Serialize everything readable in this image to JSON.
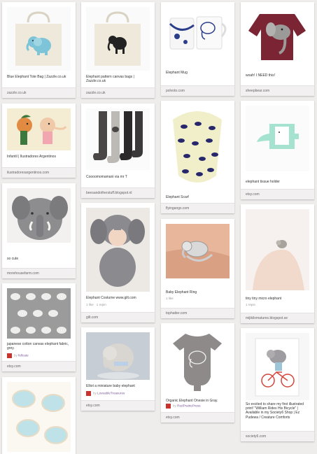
{
  "colors": {
    "background": "#efedec",
    "card": "#ffffff",
    "source_bar": "#f2f0f0",
    "avatar": "#c8332e"
  },
  "columns": [
    [
      {
        "description": "Blue Elephant Tote Bag | Zazzle.co.uk",
        "source": "zazzle.co.uk"
      },
      {
        "description": "Infantil | Ilustradores Argentinos",
        "source": "ilustradoresargentinos.com"
      },
      {
        "description": "so cute",
        "source": "morehousefarm.com"
      },
      {
        "description": "japanese cotton canvas elephant fabric, grey.",
        "via_by": "by",
        "via_user": "fellcate",
        "source": "etsy.com"
      },
      {}
    ],
    [
      {
        "description": "Elephant pattern canvas bags | Zazzle.co.uk",
        "source": "zazzle.co.uk"
      },
      {
        "description": "Coooomomamani via mr T",
        "source": "beesandotherstuff.blogspot.nl"
      },
      {
        "description": "Elephant Costume www.gilt.com",
        "likes": "1 like",
        "repins": "1 repin",
        "source": "gilt.com"
      },
      {
        "description": "Elliot a miniature baby elephant",
        "via_by": "by",
        "via_user": "LoveableTreasures",
        "source": "etsy.com"
      }
    ],
    [
      {
        "description": "Elephant Mug",
        "source": "polvoto.com"
      },
      {
        "description": "Elephant Scarf",
        "source": "flyingangx.com"
      },
      {
        "description": "Baby Elephant Ring",
        "likes": "1 like",
        "source": "tophatter.com"
      },
      {
        "description": "Organic Elephant Onesie in Gray.",
        "via_by": "by",
        "via_user": "RedPrairiePress",
        "source": "etsy.com"
      }
    ],
    [
      {
        "description": "woah! I NEED this!",
        "source": "sheepbear.com"
      },
      {
        "description": "elephant tissue holder",
        "source": "etsy.com"
      },
      {
        "description": "tiny tiny micro elephant",
        "repins": "1 repin",
        "source": "mijikilomatures.blogspot.se"
      },
      {
        "description": "So excited to share my first illustrated print! \"William Rides His Bicycle\" | Available in my Society6 Shop | Ez Pudewa / Creature Comforts",
        "source": "society6.com"
      }
    ]
  ]
}
